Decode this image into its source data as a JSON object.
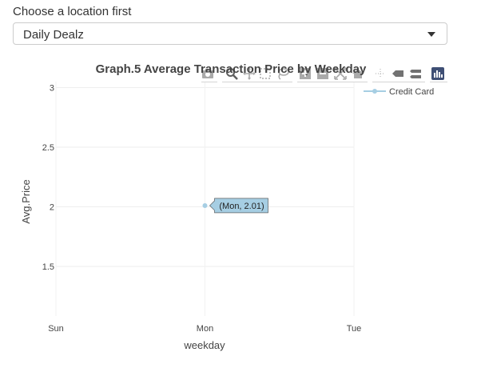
{
  "location_select": {
    "label": "Choose a location first",
    "value": "Daily Dealz"
  },
  "modebar": {
    "icons": [
      "camera-icon",
      "zoom-icon",
      "pan-icon",
      "box-select-icon",
      "lasso-icon",
      "zoom-in-icon",
      "zoom-out-icon",
      "autoscale-icon",
      "reset-axes-icon",
      "spike-lines-icon",
      "hover-closest-icon",
      "hover-compare-icon",
      "plotly-logo-icon"
    ]
  },
  "chart_data": {
    "type": "line",
    "title": "Graph.5 Average Transaction Price by Weekday",
    "xlabel": "weekday",
    "ylabel": "Avg.Price",
    "categories": [
      "Sun",
      "Mon",
      "Tue"
    ],
    "yticks": [
      "1.5",
      "2",
      "2.5",
      "3"
    ],
    "ylim": [
      1.05,
      3.05
    ],
    "grid": true,
    "legend_position": "top-right",
    "series": [
      {
        "name": "Credit Card",
        "color": "#a6cee3",
        "points": [
          {
            "x": "Mon",
            "y": 2.01
          }
        ]
      }
    ],
    "hover_label": "(Mon, 2.01)"
  }
}
